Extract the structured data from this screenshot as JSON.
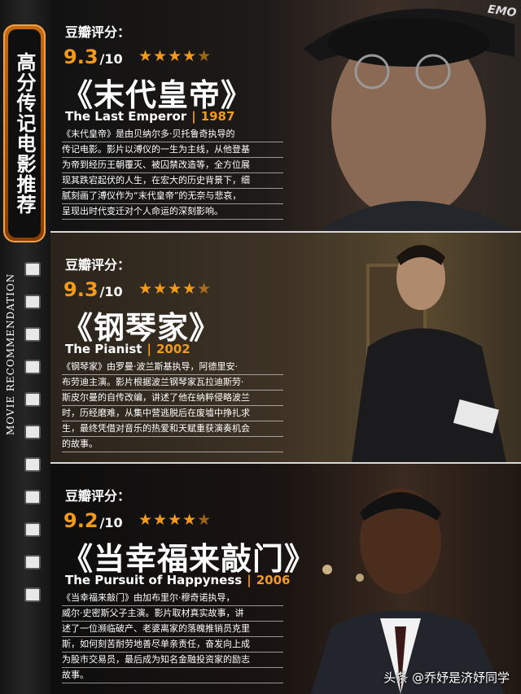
{
  "sidebar": {
    "tab_title": "高分传记电影推荐",
    "vertical_text": "MOVIE RECOMMENDATION"
  },
  "badge": "EMO",
  "movies": [
    {
      "rating_label": "豆瓣评分：",
      "score": "9.3",
      "scale": "/10",
      "stars": "★★★★",
      "half_star": "★",
      "title_cn": "《末代皇帝》",
      "title_en": "The Last Emperor",
      "sep": "|",
      "year": "1987",
      "desc": [
        "《末代皇帝》是由贝纳尔多·贝托鲁奇执导的",
        "传记电影。影片以溥仪的一生为主线，从他登基",
        "为帝到经历王朝覆灭、被囚禁改造等，全方位展",
        "现其跌宕起伏的人生，在宏大的历史背景下，细",
        "腻刻画了溥仪作为“末代皇帝”的无奈与悲哀，",
        "呈现出时代变迁对个人命运的深刻影响。"
      ]
    },
    {
      "rating_label": "豆瓣评分：",
      "score": "9.3",
      "scale": "/10",
      "stars": "★★★★",
      "half_star": "★",
      "title_cn": "《钢琴家》",
      "title_en": "The Pianist",
      "sep": "|",
      "year": "2002",
      "desc": [
        "《钢琴家》由罗曼·波兰斯基执导，阿德里安·",
        "布劳迪主演。影片根据波兰钢琴家瓦拉迪斯劳·",
        "斯皮尔曼的自传改编，讲述了他在纳粹侵略波兰",
        "时，历经磨难，从集中营逃脱后在废墟中挣扎求",
        "生，最终凭借对音乐的热爱和天赋重获演奏机会",
        "的故事。"
      ]
    },
    {
      "rating_label": "豆瓣评分：",
      "score": "9.2",
      "scale": "/10",
      "stars": "★★★★",
      "half_star": "★",
      "title_cn": "《当幸福来敲门》",
      "title_en": "The Pursuit of Happyness",
      "sep": "|",
      "year": "2006",
      "desc": [
        "《当幸福来敲门》由加布里尔·穆奇诺执导，",
        "威尔·史密斯父子主演。影片取材真实故事，讲",
        "述了一位濒临破产、老婆离家的落魄推销员克里",
        "斯，如何刻苦耐劳地善尽单亲责任，奋发向上成",
        "为股市交易员，最后成为知名金融投资家的励志",
        "故事。"
      ]
    }
  ],
  "watermark": "头条 @乔妤是济妤同学",
  "colors": {
    "accent": "#f39a1a",
    "tab": "#c66a12"
  }
}
